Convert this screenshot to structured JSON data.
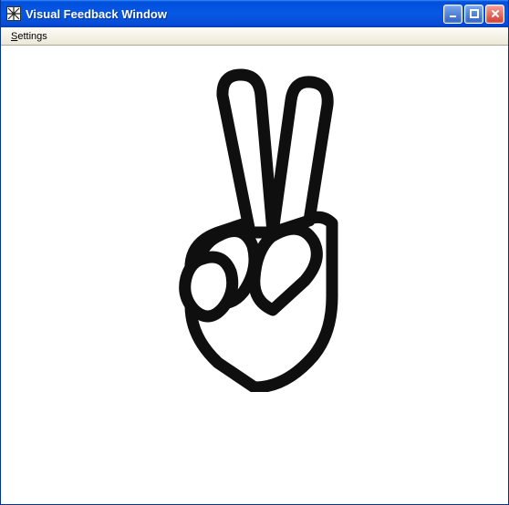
{
  "window": {
    "title": "Visual Feedback Window",
    "app_icon": "app-icon"
  },
  "menubar": {
    "settings_label": "Settings",
    "settings_underline_index": 0
  },
  "controls": {
    "minimize": "minimize-icon",
    "maximize": "maximize-icon",
    "close": "close-icon"
  },
  "content": {
    "graphic": "peace-sign-hand"
  }
}
